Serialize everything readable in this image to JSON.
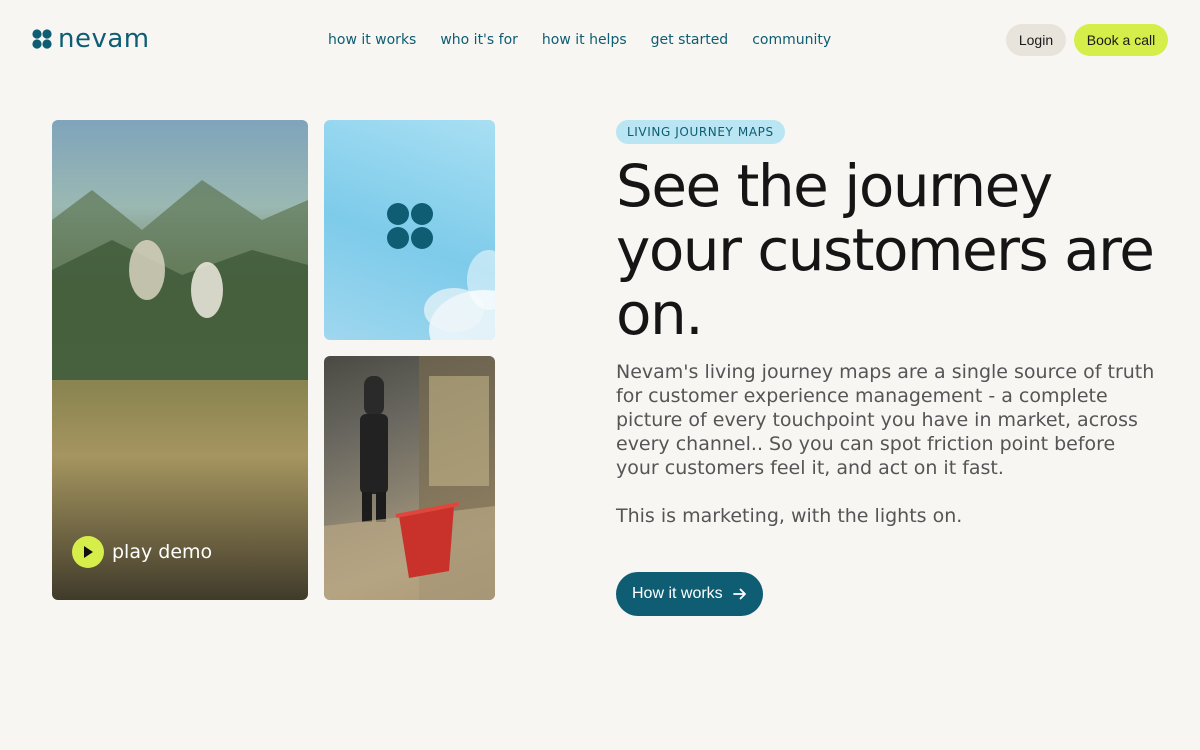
{
  "brand": {
    "name": "nevam",
    "accent": "#0e5d73",
    "highlight": "#d6ee4a",
    "logo_icon": "four-dots-logo-icon"
  },
  "nav": {
    "items": [
      {
        "label": "how it works"
      },
      {
        "label": "who it's for"
      },
      {
        "label": "how it helps"
      },
      {
        "label": "get started"
      },
      {
        "label": "community"
      }
    ]
  },
  "header": {
    "login_label": "Login",
    "book_call_label": "Book a call"
  },
  "media": {
    "play_demo_label": "play demo",
    "play_icon": "play-icon"
  },
  "hero": {
    "eyebrow": "LIVING JOURNEY MAPS",
    "headline": "See the journey your customers are on.",
    "paragraph_1": "Nevam's living journey maps are a single source of truth for customer experience management -  a complete picture of every touchpoint you have in market, across every channel..  So you can spot friction point before your customers feel it, and act on it fast.",
    "paragraph_2": "This is marketing, with the lights on.",
    "cta_label": "How it works",
    "cta_icon": "arrow-right-icon"
  }
}
